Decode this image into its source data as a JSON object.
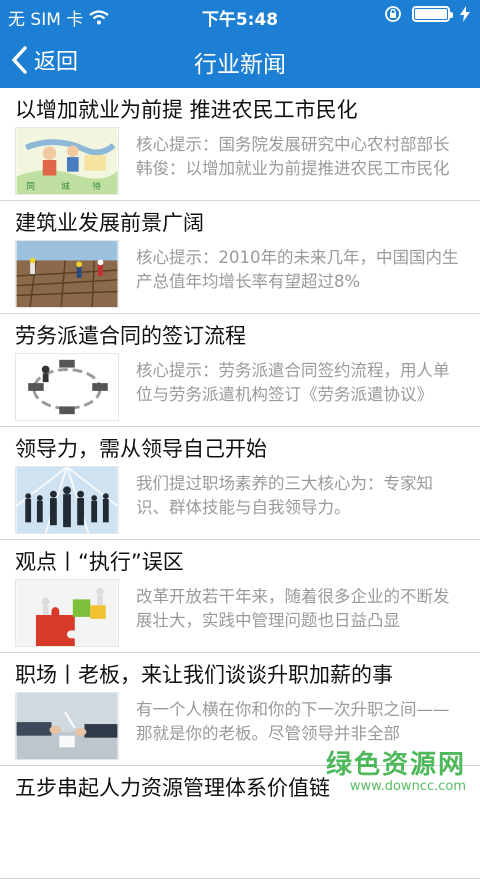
{
  "statusbar": {
    "carrier": "无 SIM 卡",
    "time": "下午5:48",
    "battery_level": 1.0
  },
  "nav": {
    "back_label": "返回",
    "title": "行业新闻"
  },
  "articles": [
    {
      "title": "以增加就业为前提 推进农民工市民化",
      "summary": "核心提示：国务院发展研究中心农村部部长韩俊：以增加就业为前提推进农民工市民化"
    },
    {
      "title": "建筑业发展前景广阔",
      "summary": "核心提示：2010年的未来几年，中国国内生产总值年均增长率有望超过8%"
    },
    {
      "title": "劳务派遣合同的签订流程",
      "summary": "核心提示：劳务派遣合同签约流程，用人单位与劳务派遣机构签订《劳务派遣协议》"
    },
    {
      "title": "领导力，需从领导自己开始",
      "summary": "我们提过职场素养的三大核心为：专家知识、群体技能与自我领导力。"
    },
    {
      "title": "观点丨“执行”误区",
      "summary": "改革开放若干年来，随着很多企业的不断发展壮大，实践中管理问题也日益凸显"
    },
    {
      "title": "职场丨老板，来让我们谈谈升职加薪的事",
      "summary": "有一个人横在你和你的下一次升职之间——那就是你的老板。尽管领导并非全部"
    },
    {
      "title": "五步串起人力资源管理体系价值链",
      "summary": ""
    }
  ],
  "thumb_texts": {
    "t0_a": "同",
    "t0_b": "城",
    "t0_c": "待"
  },
  "watermark": {
    "line1": "绿色资源网",
    "line2": "www.downcc.com"
  },
  "colors": {
    "accent": "#1c7fd3",
    "title_text": "#111111",
    "summary_text": "#9a9a9a",
    "watermark": "#3bb14a"
  }
}
